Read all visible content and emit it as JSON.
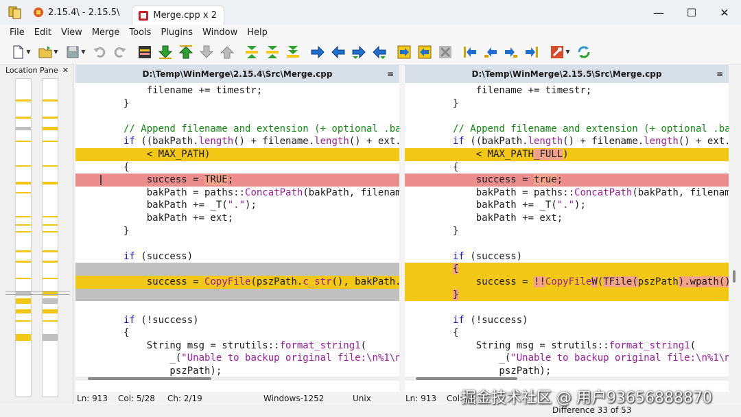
{
  "titlebar": {
    "tabs": [
      {
        "label": "2.15.4\\ - 2.15.5\\"
      },
      {
        "label": "Merge.cpp x 2"
      }
    ],
    "minimize": "—",
    "maximize": "☐",
    "close": "✕"
  },
  "menu": {
    "items": [
      "File",
      "Edit",
      "View",
      "Merge",
      "Tools",
      "Plugins",
      "Window",
      "Help"
    ]
  },
  "location_pane": {
    "title": "Location Pane",
    "close": "✕"
  },
  "left_pane": {
    "path": "D:\\Temp\\WinMerge\\2.15.4\\Src\\Merge.cpp",
    "status": {
      "ln": "Ln: 913",
      "col": "Col: 5/28",
      "ch": "Ch: 2/19",
      "encoding": "Windows-1252",
      "eol": "Unix"
    }
  },
  "right_pane": {
    "path": "D:\\Temp\\WinMerge\\2.15.5\\Src\\Merge.cpp",
    "status": {
      "ln": "Ln: 913",
      "col": "Col: 1/"
    }
  },
  "pane_menu_glyph": "≡",
  "bottom_status": {
    "difference": "Difference 33 of 53"
  },
  "watermark": "掘金技术社区 @ 用户93656888870",
  "colors": {
    "diff_yellow": "#f2c715",
    "diff_red": "#ec8d8d",
    "diff_gray": "#c0c0c0",
    "inline_highlight": "#f3a28a",
    "pane_header": "#d7dfe8"
  }
}
